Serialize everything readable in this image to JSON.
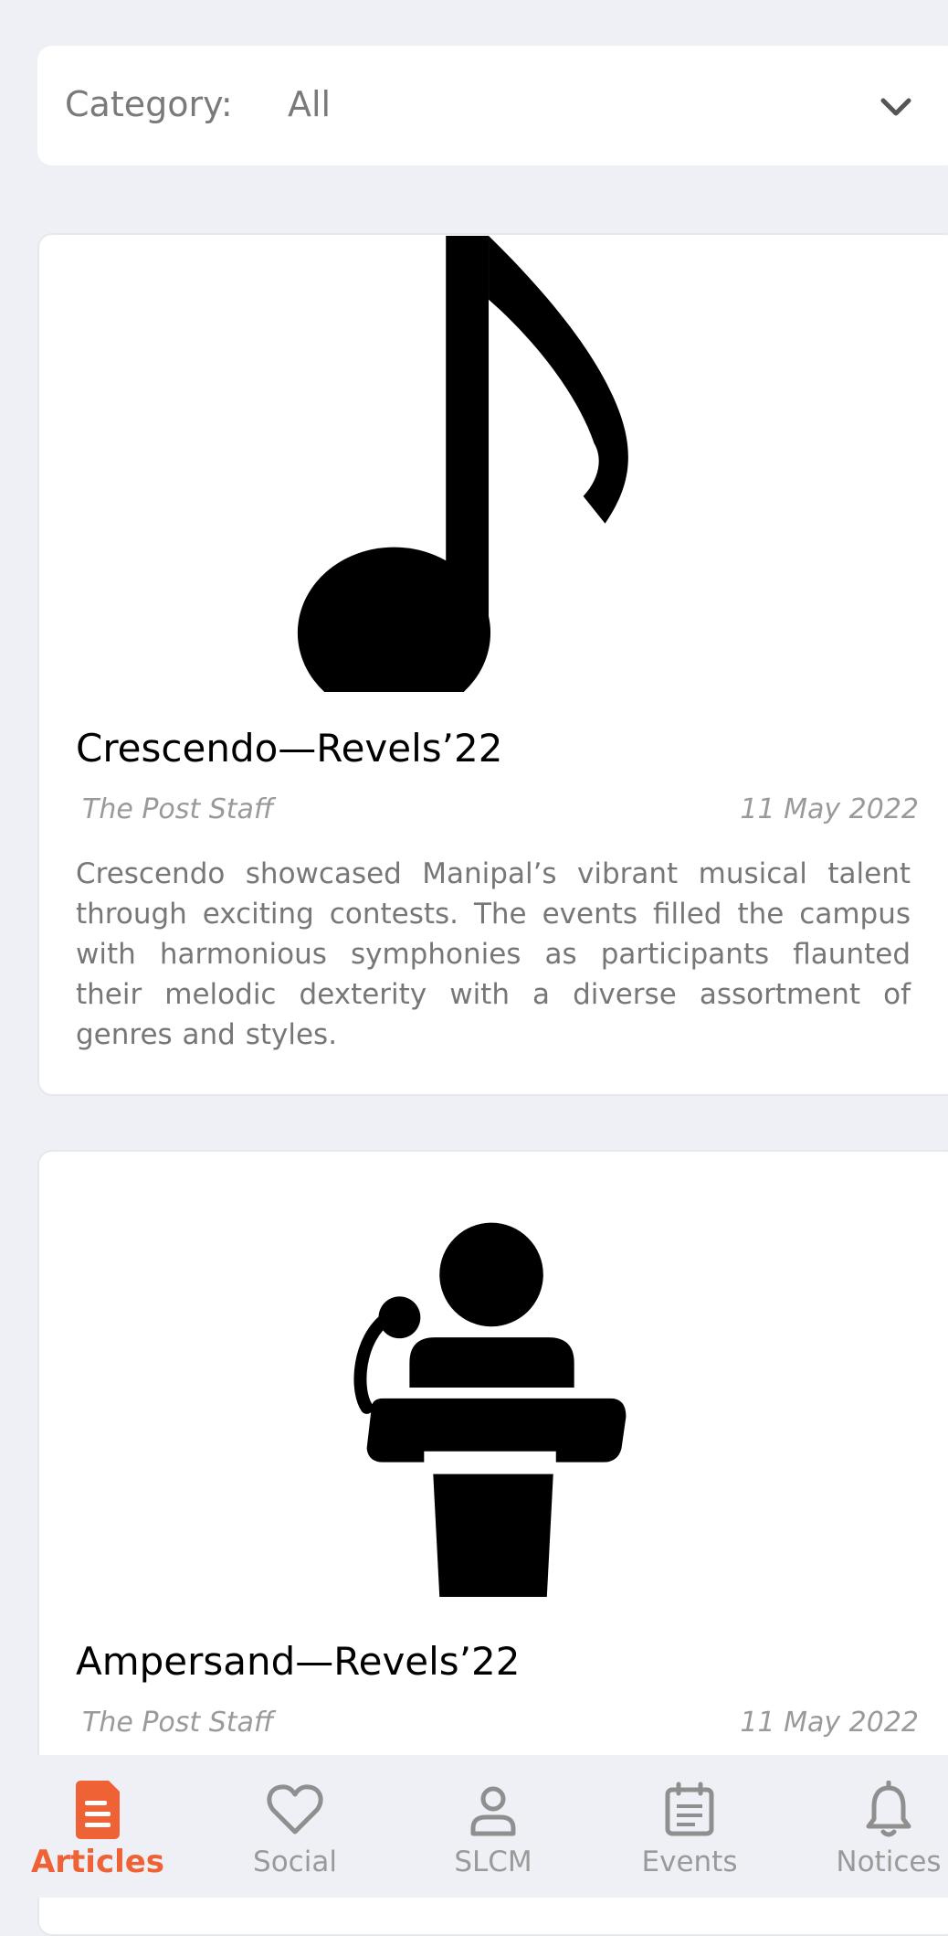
{
  "filter": {
    "label": "Category:",
    "value": "All"
  },
  "articles": [
    {
      "title": "Crescendo—Revels’22",
      "author": "The Post Staff",
      "date": "11 May 2022",
      "summary": "Crescendo showcased Manipal’s vibrant musical talent through exciting contests. The events filled the campus with harmonious symphonies as participants flaunted their melodic dexterity with a diverse assortment of genres and styles.",
      "icon": "music-note-icon"
    },
    {
      "title": "Ampersand—Revels’22",
      "author": "The Post Staff",
      "date": "11 May 2022",
      "icon": "speaker-podium-icon"
    }
  ],
  "nav": {
    "items": [
      {
        "label": "Articles",
        "icon": "document-icon",
        "active": true
      },
      {
        "label": "Social",
        "icon": "heart-icon",
        "active": false
      },
      {
        "label": "SLCM",
        "icon": "user-icon",
        "active": false
      },
      {
        "label": "Events",
        "icon": "calendar-icon",
        "active": false
      },
      {
        "label": "Notices",
        "icon": "bell-icon",
        "active": false
      }
    ]
  },
  "colors": {
    "accent": "#ee6236",
    "background": "#eef0f5",
    "card": "#ffffff",
    "muted_text": "#9a9a9a"
  }
}
